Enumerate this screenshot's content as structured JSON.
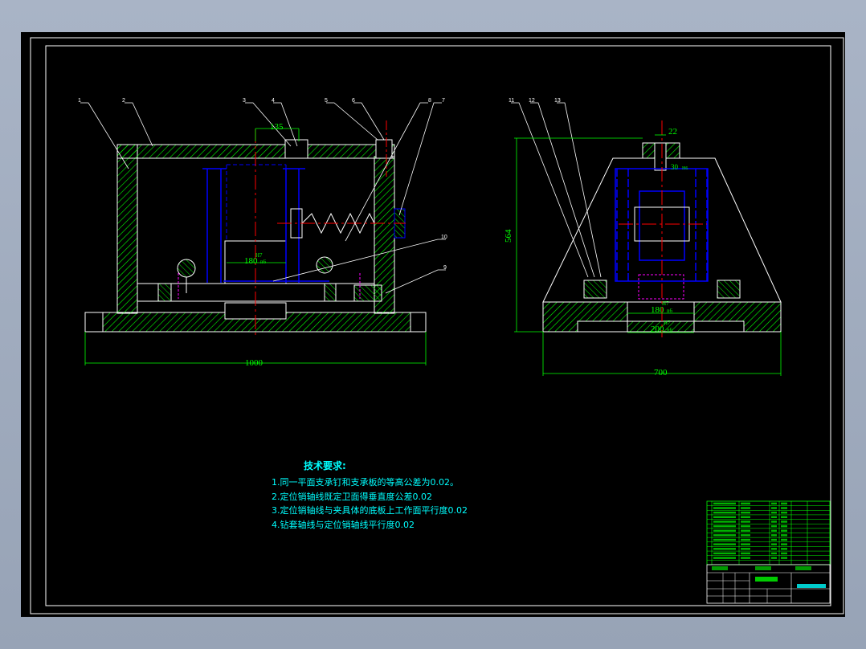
{
  "drawing": {
    "colors": {
      "background": "#000000",
      "frame": "#ffffff",
      "dimension": "#00ff00",
      "centerline": "#ff0000",
      "hidden": "#0000ff",
      "hatch": "#00ff00",
      "note": "#00ffff"
    },
    "dimensions": {
      "front_width": "1000",
      "side_width": "700",
      "side_height": "564",
      "top_offset": "135",
      "pin_fit": "180",
      "pin_fit_tol": "H7",
      "pin_fit_sub": "n6",
      "side_pin_fit": "180",
      "side_pin_tol": "H7",
      "side_pin_sub": "n6",
      "side_bore": "200",
      "side_bore_tol": "H7",
      "side_bore_sub": "n6",
      "side_top": "22",
      "side_hole": "30",
      "side_hole_sub": "H6"
    },
    "part_labels_front": [
      "1",
      "2",
      "3",
      "4",
      "5",
      "6",
      "8",
      "7",
      "10",
      "9"
    ],
    "part_labels_side": [
      "11",
      "12",
      "13"
    ],
    "notes": {
      "heading": "技术要求:",
      "items": [
        "1.同一平面支承钉和支承板的等高公差为0.02。",
        "2.定位销轴线既定卫面得垂直度公差0.02",
        "3.定位销轴线与夹具体的底板上工作面平行度0.02",
        "4.钻套轴线与定位销轴线平行度0.02"
      ]
    }
  }
}
